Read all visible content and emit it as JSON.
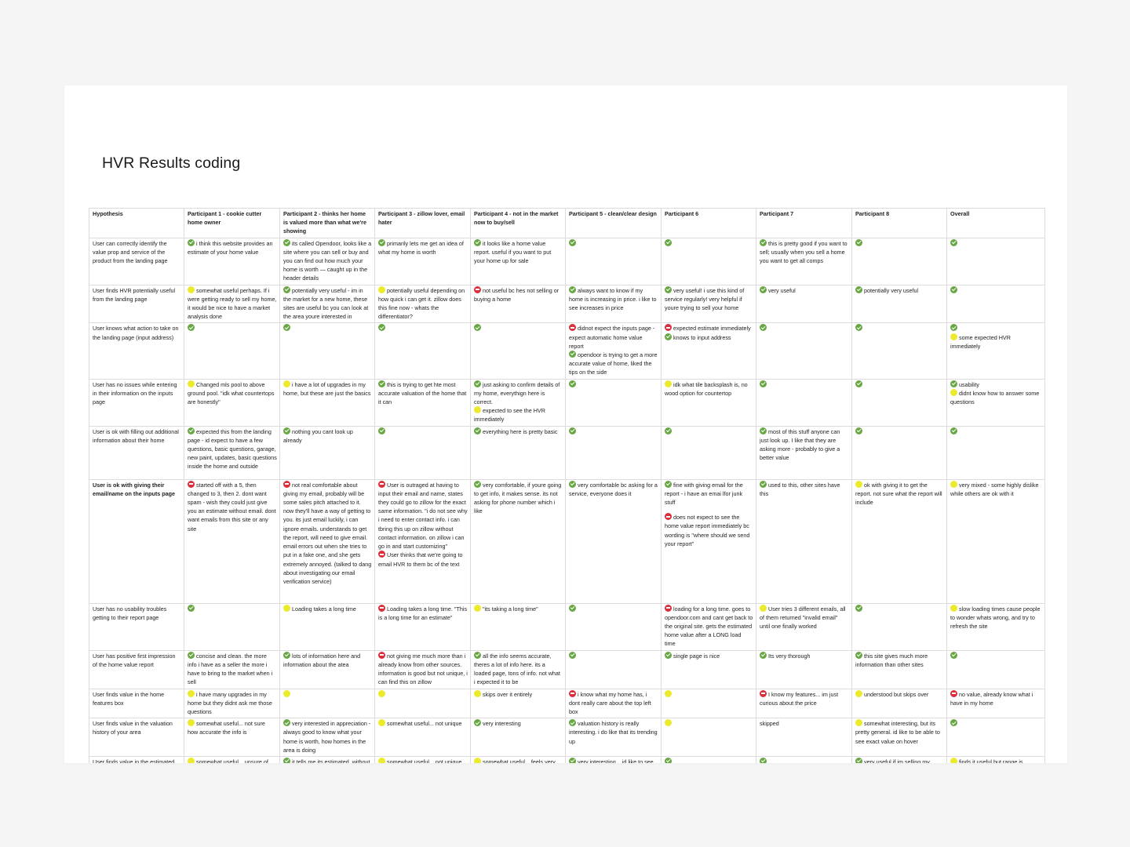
{
  "document": {
    "title": "HVR Results coding"
  },
  "legend": {
    "yes": "check-icon",
    "mixed": "yellow-dot-icon",
    "no": "no-entry-icon",
    "colors": {
      "yes": "#69a745",
      "mixed": "#ecea2d",
      "no": "#dc2f3c"
    }
  },
  "table": {
    "headers": [
      "Hypothesis",
      "Participant 1 - cookie cutter home owner",
      "Participant 2 - thinks her home is valued more than what we're showing",
      "Participant 3 - zillow lover, email hater",
      "Participant 4 - not in the market now to buy/sell",
      "Participant 5 - clean/clear design",
      "Participant 6",
      "Participant 7",
      "Participant 8",
      "Overall"
    ],
    "rows": [
      {
        "hypothesis": "User can correctly identify the value prop and service of the product from the landing page",
        "bold": false,
        "cells": [
          [
            {
              "icon": "yes",
              "text": "i think this website provides an estimate of your home value"
            }
          ],
          [
            {
              "icon": "yes",
              "text": "its called Opendoor, looks like a site where you can sell or buy and you can find out how much your home is worth — caught up in the header details"
            }
          ],
          [
            {
              "icon": "yes",
              "text": "primarily lets me get an idea of what my home is worth"
            }
          ],
          [
            {
              "icon": "yes",
              "text": "it looks like a home value report. useful if you want to put your home up for sale"
            }
          ],
          [
            {
              "icon": "yes",
              "text": ""
            }
          ],
          [
            {
              "icon": "yes",
              "text": ""
            }
          ],
          [
            {
              "icon": "yes",
              "text": "this is pretty good if you want to sell; usually when you sell a home you want to get all comps"
            }
          ],
          [
            {
              "icon": "yes",
              "text": ""
            }
          ],
          [
            {
              "icon": "yes",
              "text": ""
            }
          ]
        ]
      },
      {
        "hypothesis": "User finds HVR potentially useful from the landing page",
        "bold": false,
        "cells": [
          [
            {
              "icon": "mixed",
              "text": "somewhat useful perhaps. If i were getting ready to sell my home, it would be nice to have a market analysis done"
            }
          ],
          [
            {
              "icon": "yes",
              "text": "potentially very useful - im in the market for a new home, these sites are useful bc you can look at the area youre interested in"
            }
          ],
          [
            {
              "icon": "mixed",
              "text": "potentially useful depending on how quick i can get it. zillow does this fine now - whats the differentiator?"
            }
          ],
          [
            {
              "icon": "no",
              "text": "not useful bc hes not selling or buying a home"
            }
          ],
          [
            {
              "icon": "yes",
              "text": "always want to know if my home is increasing in price. i like to see increases in price"
            }
          ],
          [
            {
              "icon": "yes",
              "text": "very useful! i use this kind of service regularly! very helpful if youre trying to sell your home"
            }
          ],
          [
            {
              "icon": "yes",
              "text": "very useful"
            }
          ],
          [
            {
              "icon": "yes",
              "text": "potentially very useful"
            }
          ],
          [
            {
              "icon": "yes",
              "text": ""
            }
          ]
        ]
      },
      {
        "hypothesis": "User knows what action to take on the landing page (input address)",
        "bold": false,
        "cells": [
          [
            {
              "icon": "yes",
              "text": ""
            }
          ],
          [
            {
              "icon": "yes",
              "text": ""
            }
          ],
          [
            {
              "icon": "yes",
              "text": ""
            }
          ],
          [
            {
              "icon": "yes",
              "text": ""
            }
          ],
          [
            {
              "icon": "no",
              "text": "didnot expect the inputs page - expect automatic home value report"
            },
            {
              "icon": "yes",
              "text": "opendoor is trying to get a more accurate value of home, liked the tips on the side"
            }
          ],
          [
            {
              "icon": "no",
              "text": "expected estimate immediately"
            },
            {
              "icon": "yes",
              "text": "knows to input address"
            }
          ],
          [
            {
              "icon": "yes",
              "text": ""
            }
          ],
          [
            {
              "icon": "yes",
              "text": ""
            }
          ],
          [
            {
              "icon": "yes",
              "text": ""
            },
            {
              "icon": "mixed",
              "text": "some expected HVR immediately"
            }
          ]
        ]
      },
      {
        "hypothesis": "User has no issues while entering in their information on the inputs page",
        "bold": false,
        "cells": [
          [
            {
              "icon": "mixed",
              "text": "Changed mls pool to above ground pool. \"idk what countertops are honestly\""
            }
          ],
          [
            {
              "icon": "mixed",
              "text": "i have a lot of upgrades in my home, but these are just the basics"
            }
          ],
          [
            {
              "icon": "yes",
              "text": "this is trying to get hte most accurate valuation of the home that it can"
            }
          ],
          [
            {
              "icon": "yes",
              "text": "just asking to confirm details of my home, everythign here is correct."
            },
            {
              "icon": "mixed",
              "text": "expected to see the HVR immediately"
            }
          ],
          [
            {
              "icon": "yes",
              "text": ""
            }
          ],
          [
            {
              "icon": "mixed",
              "text": "idk what tile backsplash is, no wood option for countertop"
            }
          ],
          [
            {
              "icon": "yes",
              "text": ""
            }
          ],
          [
            {
              "icon": "yes",
              "text": ""
            }
          ],
          [
            {
              "icon": "yes",
              "text": "usability"
            },
            {
              "icon": "mixed",
              "text": "didnt know how to answer some questions"
            }
          ]
        ]
      },
      {
        "hypothesis": "User is ok with filling out additional information about their home",
        "bold": false,
        "cells": [
          [
            {
              "icon": "yes",
              "text": "expected this from the landing page - id expect to have a few questions, basic questions, garage, new paint, updates, basic questions inside the home and outside"
            }
          ],
          [
            {
              "icon": "yes",
              "text": "nothing you cant look up already"
            }
          ],
          [
            {
              "icon": "yes",
              "text": ""
            }
          ],
          [
            {
              "icon": "yes",
              "text": "everything here is pretty basic"
            }
          ],
          [
            {
              "icon": "yes",
              "text": ""
            }
          ],
          [
            {
              "icon": "yes",
              "text": ""
            }
          ],
          [
            {
              "icon": "yes",
              "text": "most of this stuff anyone can just look up. I like that they are asking more - probably to give a better value"
            }
          ],
          [
            {
              "icon": "yes",
              "text": ""
            }
          ],
          [
            {
              "icon": "yes",
              "text": ""
            }
          ]
        ]
      },
      {
        "hypothesis": "User is ok with giving their email/name on the inputs page",
        "bold": true,
        "cells": [
          [
            {
              "icon": "no",
              "text": "started off with a 5, then changed to 3, then 2. dont want spam - wish they could just give you an estimate without email. dont want emails from this site or any site"
            }
          ],
          [
            {
              "icon": "no",
              "text": "not real comfortable about giving my email, probably will be some sales pitch attached to it. now they'll have a way of getting to you. its just email luckily, i can ignore emails. understands to get the report, will need to give email. email errors out when she tries to put in a fake one, and she gets extremely annoyed. (talked to dang about investigating our email verification service)"
            }
          ],
          [
            {
              "icon": "no",
              "text": "User is outraged at having to input their email and name, states they could go to zillow for the exact same information. \"i do not see why i need to enter contact info. i can tbring this up on zillow without contact information. on zillow i can go in and start customizing\""
            },
            {
              "icon": "no",
              "text": "User thinks that we're going to email HVR to them bc of the text"
            }
          ],
          [
            {
              "icon": "yes",
              "text": "very comfortable, if youre going to get info, it makes sense. its not asking for phone number which i like"
            }
          ],
          [
            {
              "icon": "yes",
              "text": "very comfortable bc asking for a service, everyone does it"
            }
          ],
          [
            {
              "icon": "yes",
              "text": "fine with giving email for the report - i have an emai lfor junk stuff"
            },
            {
              "icon": "no",
              "text": "does not expect to see the home value report immediately bc wording is \"where should we send your report\"",
              "gap": true
            }
          ],
          [
            {
              "icon": "yes",
              "text": "used to this, other sites have this"
            }
          ],
          [
            {
              "icon": "mixed",
              "text": "ok with giving it to get the report. not sure what the report will include"
            }
          ],
          [
            {
              "icon": "mixed",
              "text": "very mixed - some highly dislike while others are ok with it"
            }
          ]
        ]
      },
      {
        "hypothesis": "User has no usability troubles getting to their report page",
        "bold": false,
        "cells": [
          [
            {
              "icon": "yes",
              "text": ""
            }
          ],
          [
            {
              "icon": "mixed",
              "text": "Loading takes a long time"
            }
          ],
          [
            {
              "icon": "no",
              "text": "Loading takes a long time. \"This is a long time for an estimate\""
            }
          ],
          [
            {
              "icon": "mixed",
              "text": "\"its taking a long time\""
            }
          ],
          [
            {
              "icon": "yes",
              "text": ""
            }
          ],
          [
            {
              "icon": "no",
              "text": "loading for a long time. goes to opendoor.com and cant get back to the original site. gets the estimated home value after a LONG load time"
            }
          ],
          [
            {
              "icon": "mixed",
              "text": "User tries 3 different emails, all of them returned \"invalid email\" until one finally worked"
            }
          ],
          [
            {
              "icon": "yes",
              "text": ""
            }
          ],
          [
            {
              "icon": "mixed",
              "text": "slow loading times cause people to wonder whats wrong, and try to refresh the site"
            }
          ]
        ]
      },
      {
        "hypothesis": "User has positive first impression of the home value report",
        "bold": false,
        "cells": [
          [
            {
              "icon": "yes",
              "text": "concise and clean. the more info i have as a seller the more i have to bring to the market when i sell"
            }
          ],
          [
            {
              "icon": "yes",
              "text": "lots of information here and information about the atea"
            }
          ],
          [
            {
              "icon": "no",
              "text": "not giving me much more than i already know from other sources. information is good but not unique, i can find this on zillow"
            }
          ],
          [
            {
              "icon": "yes",
              "text": "all the info seems accurate, theres a lot of info here. its a loaded page, tons of info. not what i expected it to be"
            }
          ],
          [
            {
              "icon": "yes",
              "text": ""
            }
          ],
          [
            {
              "icon": "yes",
              "text": "single page is nice"
            }
          ],
          [
            {
              "icon": "yes",
              "text": "Its very thorough"
            }
          ],
          [
            {
              "icon": "yes",
              "text": "this site gives much more information than other sites"
            }
          ],
          [
            {
              "icon": "yes",
              "text": ""
            }
          ]
        ]
      },
      {
        "hypothesis": "User finds value in the home features box",
        "bold": false,
        "cells": [
          [
            {
              "icon": "mixed",
              "text": "i have many upgrades in my home but they didnt ask me those questions"
            }
          ],
          [
            {
              "icon": "mixed",
              "text": ""
            }
          ],
          [
            {
              "icon": "mixed",
              "text": ""
            }
          ],
          [
            {
              "icon": "mixed",
              "text": "skips over it entirely"
            }
          ],
          [
            {
              "icon": "no",
              "text": "i know what my home has, i dont really care about the top left box"
            }
          ],
          [
            {
              "icon": "mixed",
              "text": ""
            }
          ],
          [
            {
              "icon": "no",
              "text": "I know my features... im just curious about the price"
            }
          ],
          [
            {
              "icon": "mixed",
              "text": "understood but skips over"
            }
          ],
          [
            {
              "icon": "no",
              "text": "no value, already know what i have in my home"
            }
          ]
        ]
      },
      {
        "hypothesis": "User finds value in the valuation history of your area",
        "bold": false,
        "cells": [
          [
            {
              "icon": "mixed",
              "text": "somewhat useful... not sure how accurate the info is"
            }
          ],
          [
            {
              "icon": "yes",
              "text": "very interested in appreciation - always good to know what your home is worth, how homes in the area is doing"
            }
          ],
          [
            {
              "icon": "mixed",
              "text": "somewhat useful... not unique"
            }
          ],
          [
            {
              "icon": "yes",
              "text": "very interesting"
            }
          ],
          [
            {
              "icon": "yes",
              "text": "valuation history is really interesting. i do like that its trending up"
            }
          ],
          [
            {
              "icon": "mixed",
              "text": ""
            }
          ],
          [
            {
              "icon": "",
              "text": "skipped"
            }
          ],
          [
            {
              "icon": "mixed",
              "text": "somewhat interesting, but its pretty general. id like to be able to see exact value on hover"
            }
          ],
          [
            {
              "icon": "yes",
              "text": ""
            }
          ]
        ]
      },
      {
        "hypothesis": "User finds value in the estimated home value",
        "bold": false,
        "cells": [
          [
            {
              "icon": "mixed",
              "text": "somewhat useful... unsure of their estimate, its telling me what its based on but its very vague,"
            }
          ],
          [
            {
              "icon": "yes",
              "text": "it tells me its estimated. without giving more info its just a ballpark. this value was probably calculated by a computer. i like the"
            }
          ],
          [
            {
              "icon": "mixed",
              "text": "somewhat useful... not unique"
            }
          ],
          [
            {
              "icon": "mixed",
              "text": "somewhat useful... feels very vague. want more information. i want to know where i fall"
            }
          ],
          [
            {
              "icon": "yes",
              "text": "very interesting... id like to see my valuation on the top, thats what im looking for."
            }
          ],
          [
            {
              "icon": "yes",
              "text": ""
            }
          ],
          [
            {
              "icon": "yes",
              "text": ""
            }
          ],
          [
            {
              "icon": "yes",
              "text": "very useful if im selling my home"
            }
          ],
          [
            {
              "icon": "mixed",
              "text": "finds it useful but range is sometimes large"
            }
          ]
        ]
      }
    ]
  }
}
